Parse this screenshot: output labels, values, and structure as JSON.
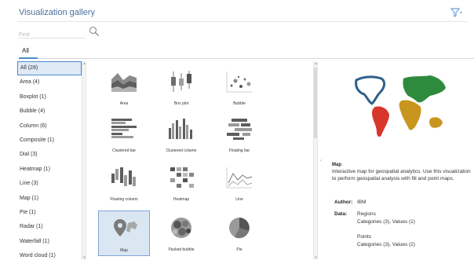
{
  "header": {
    "title": "Visualization gallery"
  },
  "search": {
    "placeholder": "Find"
  },
  "tabs": [
    {
      "label": "All"
    }
  ],
  "categories": [
    {
      "label": "All (28)",
      "selected": true
    },
    {
      "label": "Area (4)"
    },
    {
      "label": "Boxplot (1)"
    },
    {
      "label": "Bubble (4)"
    },
    {
      "label": "Column (6)"
    },
    {
      "label": "Composite (1)"
    },
    {
      "label": "Dial (3)"
    },
    {
      "label": "Heatmap (1)"
    },
    {
      "label": "Line (3)"
    },
    {
      "label": "Map (1)"
    },
    {
      "label": "Pie (1)"
    },
    {
      "label": "Radar (1)"
    },
    {
      "label": "Waterfall (1)"
    },
    {
      "label": "Word cloud (1)"
    }
  ],
  "gallery": [
    {
      "label": "Area",
      "icon": "area-chart-icon"
    },
    {
      "label": "Box plot",
      "icon": "box-plot-icon"
    },
    {
      "label": "Bubble",
      "icon": "bubble-chart-icon"
    },
    {
      "label": "Clustered bar",
      "icon": "clustered-bar-icon"
    },
    {
      "label": "Clustered column",
      "icon": "clustered-column-icon"
    },
    {
      "label": "Floating bar",
      "icon": "floating-bar-icon"
    },
    {
      "label": "Floating column",
      "icon": "floating-column-icon"
    },
    {
      "label": "Heatmap",
      "icon": "heatmap-icon"
    },
    {
      "label": "Line",
      "icon": "line-chart-icon"
    },
    {
      "label": "Map",
      "icon": "map-icon",
      "selected": true
    },
    {
      "label": "Packed bubble",
      "icon": "packed-bubble-icon"
    },
    {
      "label": "Pie",
      "icon": "pie-chart-icon"
    }
  ],
  "detail": {
    "name": "Map",
    "description": "Interactive map for geospatial analytics. Use this visualization to perform geospatial analysis with fill and point maps.",
    "author_label": "Author:",
    "author": "IBM",
    "data_label": "Data:",
    "regions_title": "Regions",
    "regions_detail": "Categories (3), Values (1)",
    "points_title": "Points",
    "points_detail": "Categories (3), Values (2)"
  },
  "colors": {
    "accent": "#4d8bd2",
    "map_blue": "#2f5f8a",
    "map_green": "#2e8b3e",
    "map_gold": "#c8961e",
    "map_red": "#d9362b"
  }
}
